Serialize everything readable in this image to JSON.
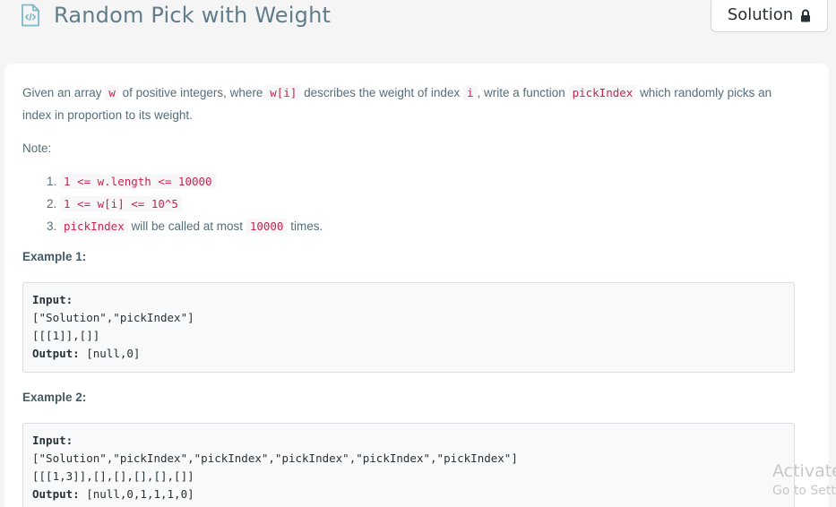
{
  "header": {
    "title": "Random Pick with Weight",
    "title_icon": "code-document-icon",
    "solution_label": "Solution",
    "solution_icon": "lock-icon"
  },
  "description": {
    "p1_a": "Given an array",
    "p1_code_w": "w",
    "p1_b": "of positive integers, where",
    "p1_code_wi": "w[i]",
    "p1_c": "describes the weight of index",
    "p1_code_i": "i",
    "p1_d": ", write a function",
    "p1_code_fn": "pickIndex",
    "p1_e": "which randomly picks an index in proportion to its weight.",
    "note_label": "Note:",
    "notes": [
      {
        "code": "1 <= w.length <= 10000"
      },
      {
        "code": "1 <= w[i] <= 10^5"
      },
      {
        "code_a": "pickIndex",
        "text_a": "will be called at most",
        "code_b": "10000",
        "text_b": "times."
      }
    ]
  },
  "examples": [
    {
      "title": "Example 1:",
      "input_label": "Input:",
      "input_line1": "[\"Solution\",\"pickIndex\"]",
      "input_line2": "[[[1]],[]]",
      "output_label": "Output:",
      "output_value": "[null,0]"
    },
    {
      "title": "Example 2:",
      "input_label": "Input:",
      "input_line1": "[\"Solution\",\"pickIndex\",\"pickIndex\",\"pickIndex\",\"pickIndex\",\"pickIndex\"]",
      "input_line2": "[[[1,3]],[],[],[],[],[]]",
      "output_label": "Output:",
      "output_value": "[null,0,1,1,1,0]"
    }
  ],
  "watermark": {
    "line1": "Activate",
    "line2": "Go to Setti"
  },
  "colors": {
    "code_text": "#c7254e",
    "code_bg": "#f7f7f9",
    "body_text": "#546e7a"
  }
}
